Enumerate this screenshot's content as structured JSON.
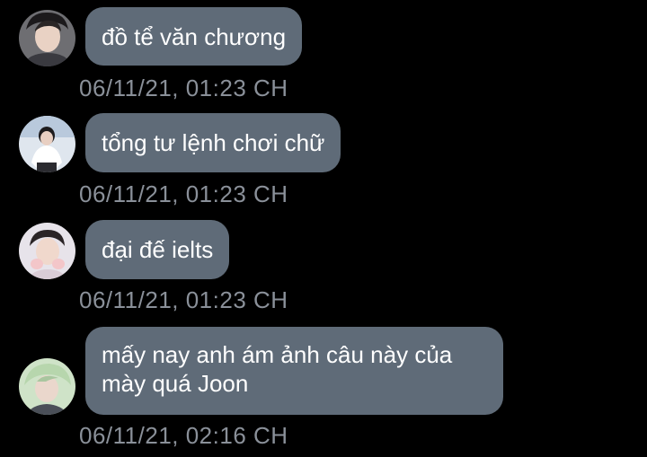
{
  "messages": [
    {
      "text": "đồ tể văn chương",
      "timestamp": "06/11/21, 01:23 CH",
      "avatar_icon": "profile-photo-icon"
    },
    {
      "text": "tổng tư lệnh chơi chữ",
      "timestamp": "06/11/21, 01:23 CH",
      "avatar_icon": "profile-photo-icon"
    },
    {
      "text": "đại đế ielts",
      "timestamp": "06/11/21, 01:23 CH",
      "avatar_icon": "profile-photo-icon"
    },
    {
      "text": "mấy nay anh ám ảnh câu này của mày quá Joon",
      "timestamp": "06/11/21, 02:16 CH",
      "avatar_icon": "profile-photo-icon"
    }
  ],
  "colors": {
    "background": "#000000",
    "bubble": "#5f6b78",
    "bubble_text": "#ffffff",
    "timestamp": "#8a9099"
  }
}
